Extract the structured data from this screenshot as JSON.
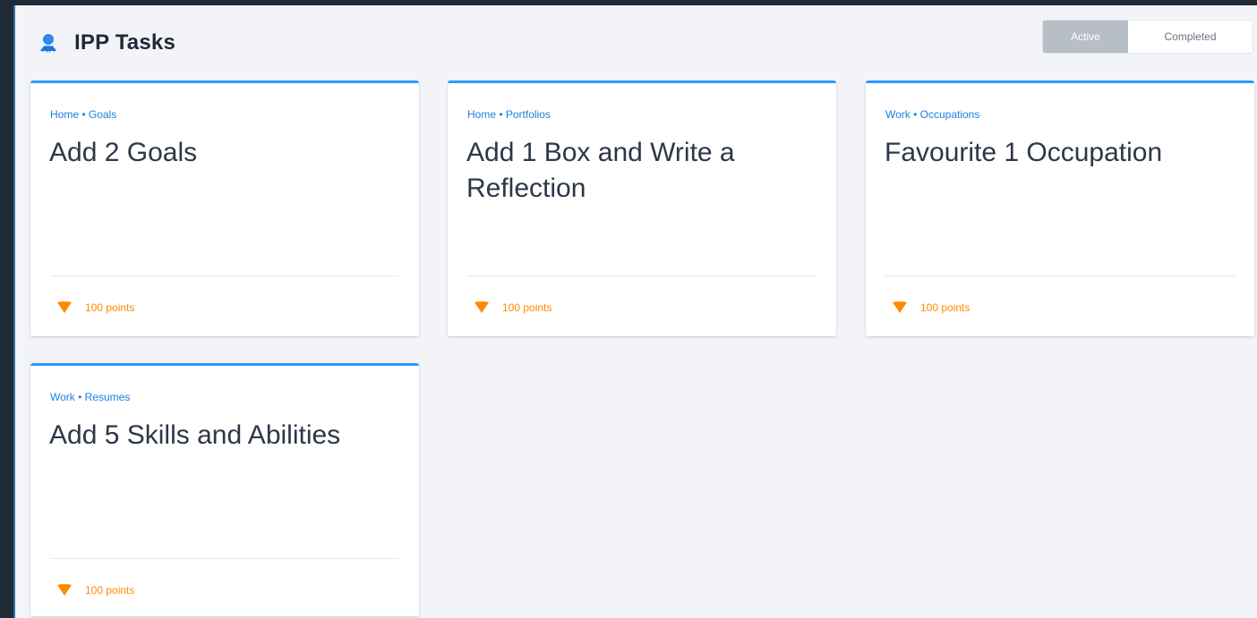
{
  "header": {
    "title": "IPP Tasks",
    "icon": "user-award-icon"
  },
  "filters": {
    "active_label": "Active",
    "completed_label": "Completed",
    "selected": "Active"
  },
  "colors": {
    "accent": "#2a9aff",
    "points": "#ff8a00",
    "toggle_active": "#b8bec6"
  },
  "tasks": [
    {
      "category": "Home • Goals",
      "title": "Add 2 Goals",
      "points": "100 points",
      "icon": "gem-icon"
    },
    {
      "category": "Home • Portfolios",
      "title": "Add 1 Box and Write a Reflection",
      "points": "100 points",
      "icon": "gem-icon"
    },
    {
      "category": "Work • Occupations",
      "title": "Favourite 1 Occupation",
      "points": "100 points",
      "icon": "gem-icon"
    },
    {
      "category": "Work • Resumes",
      "title": "Add 5 Skills and Abilities",
      "points": "100 points",
      "icon": "gem-icon"
    }
  ]
}
